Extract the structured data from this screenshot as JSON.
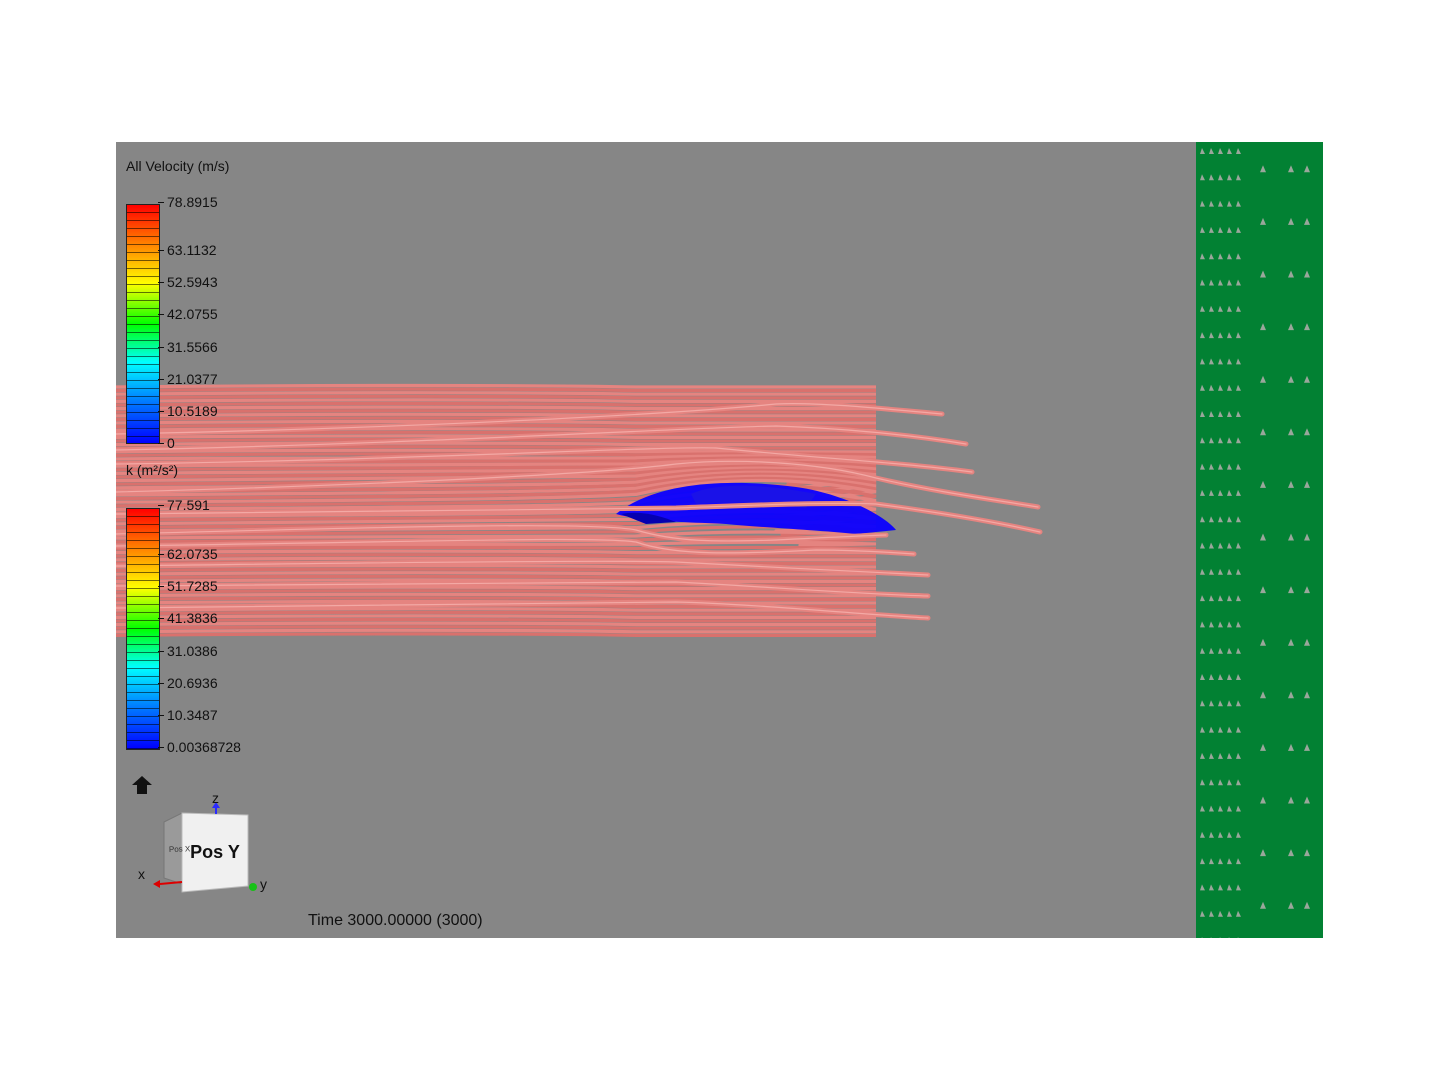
{
  "legends": [
    {
      "title": "All Velocity (m/s)",
      "ticks": [
        "78.8915",
        "63.1132",
        "52.5943",
        "42.0755",
        "31.5566",
        "21.0377",
        "10.5189",
        "0"
      ]
    },
    {
      "title": "k (m²/s²)",
      "ticks": [
        "77.591",
        "62.0735",
        "51.7285",
        "41.3836",
        "31.0386",
        "20.6936",
        "10.3487",
        "0.00368728"
      ]
    }
  ],
  "orientation": {
    "face_label": "Pos Y",
    "axis_x": "x",
    "axis_y": "y",
    "axis_z": "z"
  },
  "time_label": "Time 3000.00000 (3000)",
  "colors": {
    "viewport_bg": "#868686",
    "streamline": "#e58480",
    "body": "#0a00ff",
    "ground": "#028133"
  }
}
